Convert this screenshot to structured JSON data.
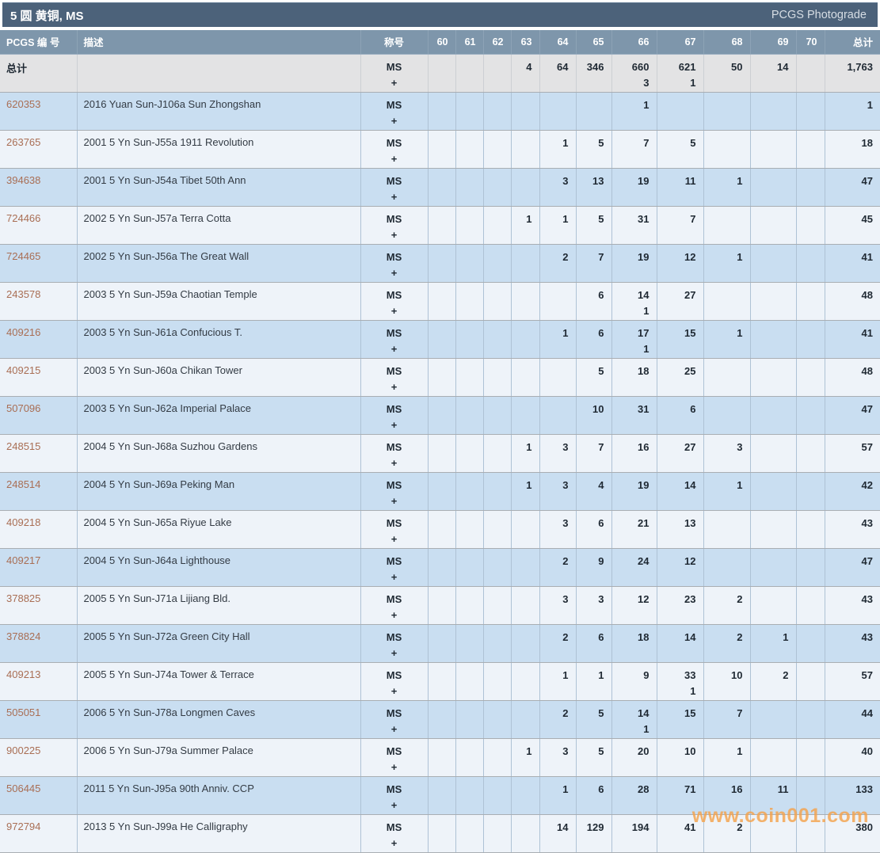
{
  "header": {
    "title": "5 圆 黄铜, MS",
    "right_link": "PCGS Photograde"
  },
  "table": {
    "fixed_headers": [
      "PCGS 编 号",
      "描述",
      "称号"
    ],
    "grade_columns": [
      "60",
      "61",
      "62",
      "63",
      "64",
      "65",
      "66",
      "67",
      "68",
      "69",
      "70"
    ],
    "total_header": "总计",
    "designation": [
      "MS",
      "+"
    ],
    "totals_row": {
      "label": "总计",
      "grades": {
        "63": [
          4,
          null
        ],
        "64": [
          64,
          null
        ],
        "65": [
          346,
          null
        ],
        "66": [
          660,
          3
        ],
        "67": [
          621,
          1
        ],
        "68": [
          50,
          null
        ],
        "69": [
          14,
          null
        ]
      },
      "total": "1,763"
    },
    "rows": [
      {
        "id": "620353",
        "desc": "2016 Yuan Sun-J106a Sun Zhongshan",
        "grades": {
          "66": [
            1,
            null
          ]
        },
        "total": "1"
      },
      {
        "id": "263765",
        "desc": "2001 5 Yn Sun-J55a 1911 Revolution",
        "grades": {
          "64": [
            1,
            null
          ],
          "65": [
            5,
            null
          ],
          "66": [
            7,
            null
          ],
          "67": [
            5,
            null
          ]
        },
        "total": "18"
      },
      {
        "id": "394638",
        "desc": "2001 5 Yn Sun-J54a Tibet 50th Ann",
        "grades": {
          "64": [
            3,
            null
          ],
          "65": [
            13,
            null
          ],
          "66": [
            19,
            null
          ],
          "67": [
            11,
            null
          ],
          "68": [
            1,
            null
          ]
        },
        "total": "47"
      },
      {
        "id": "724466",
        "desc": "2002 5 Yn Sun-J57a Terra Cotta",
        "grades": {
          "63": [
            1,
            null
          ],
          "64": [
            1,
            null
          ],
          "65": [
            5,
            null
          ],
          "66": [
            31,
            null
          ],
          "67": [
            7,
            null
          ]
        },
        "total": "45"
      },
      {
        "id": "724465",
        "desc": "2002 5 Yn Sun-J56a The Great Wall",
        "grades": {
          "64": [
            2,
            null
          ],
          "65": [
            7,
            null
          ],
          "66": [
            19,
            null
          ],
          "67": [
            12,
            null
          ],
          "68": [
            1,
            null
          ]
        },
        "total": "41"
      },
      {
        "id": "243578",
        "desc": "2003 5 Yn Sun-J59a Chaotian Temple",
        "grades": {
          "65": [
            6,
            null
          ],
          "66": [
            14,
            1
          ],
          "67": [
            27,
            null
          ]
        },
        "total": "48"
      },
      {
        "id": "409216",
        "desc": "2003 5 Yn Sun-J61a Confucious T.",
        "grades": {
          "64": [
            1,
            null
          ],
          "65": [
            6,
            null
          ],
          "66": [
            17,
            1
          ],
          "67": [
            15,
            null
          ],
          "68": [
            1,
            null
          ]
        },
        "total": "41"
      },
      {
        "id": "409215",
        "desc": "2003 5 Yn Sun-J60a Chikan Tower",
        "grades": {
          "65": [
            5,
            null
          ],
          "66": [
            18,
            null
          ],
          "67": [
            25,
            null
          ]
        },
        "total": "48"
      },
      {
        "id": "507096",
        "desc": "2003 5 Yn Sun-J62a Imperial Palace",
        "grades": {
          "65": [
            10,
            null
          ],
          "66": [
            31,
            null
          ],
          "67": [
            6,
            null
          ]
        },
        "total": "47"
      },
      {
        "id": "248515",
        "desc": "2004 5 Yn Sun-J68a Suzhou Gardens",
        "grades": {
          "63": [
            1,
            null
          ],
          "64": [
            3,
            null
          ],
          "65": [
            7,
            null
          ],
          "66": [
            16,
            null
          ],
          "67": [
            27,
            null
          ],
          "68": [
            3,
            null
          ]
        },
        "total": "57"
      },
      {
        "id": "248514",
        "desc": "2004 5 Yn Sun-J69a Peking Man",
        "grades": {
          "63": [
            1,
            null
          ],
          "64": [
            3,
            null
          ],
          "65": [
            4,
            null
          ],
          "66": [
            19,
            null
          ],
          "67": [
            14,
            null
          ],
          "68": [
            1,
            null
          ]
        },
        "total": "42"
      },
      {
        "id": "409218",
        "desc": "2004 5 Yn Sun-J65a Riyue Lake",
        "grades": {
          "64": [
            3,
            null
          ],
          "65": [
            6,
            null
          ],
          "66": [
            21,
            null
          ],
          "67": [
            13,
            null
          ]
        },
        "total": "43"
      },
      {
        "id": "409217",
        "desc": "2004 5 Yn Sun-J64a Lighthouse",
        "grades": {
          "64": [
            2,
            null
          ],
          "65": [
            9,
            null
          ],
          "66": [
            24,
            null
          ],
          "67": [
            12,
            null
          ]
        },
        "total": "47"
      },
      {
        "id": "378825",
        "desc": "2005 5 Yn Sun-J71a Lijiang Bld.",
        "grades": {
          "64": [
            3,
            null
          ],
          "65": [
            3,
            null
          ],
          "66": [
            12,
            null
          ],
          "67": [
            23,
            null
          ],
          "68": [
            2,
            null
          ]
        },
        "total": "43"
      },
      {
        "id": "378824",
        "desc": "2005 5 Yn Sun-J72a Green City Hall",
        "grades": {
          "64": [
            2,
            null
          ],
          "65": [
            6,
            null
          ],
          "66": [
            18,
            null
          ],
          "67": [
            14,
            null
          ],
          "68": [
            2,
            null
          ],
          "69": [
            1,
            null
          ]
        },
        "total": "43"
      },
      {
        "id": "409213",
        "desc": "2005 5 Yn Sun-J74a Tower & Terrace",
        "grades": {
          "64": [
            1,
            null
          ],
          "65": [
            1,
            null
          ],
          "66": [
            9,
            null
          ],
          "67": [
            33,
            1
          ],
          "68": [
            10,
            null
          ],
          "69": [
            2,
            null
          ]
        },
        "total": "57"
      },
      {
        "id": "505051",
        "desc": "2006 5 Yn Sun-J78a Longmen Caves",
        "grades": {
          "64": [
            2,
            null
          ],
          "65": [
            5,
            null
          ],
          "66": [
            14,
            1
          ],
          "67": [
            15,
            null
          ],
          "68": [
            7,
            null
          ]
        },
        "total": "44"
      },
      {
        "id": "900225",
        "desc": "2006 5 Yn Sun-J79a Summer Palace",
        "grades": {
          "63": [
            1,
            null
          ],
          "64": [
            3,
            null
          ],
          "65": [
            5,
            null
          ],
          "66": [
            20,
            null
          ],
          "67": [
            10,
            null
          ],
          "68": [
            1,
            null
          ]
        },
        "total": "40"
      },
      {
        "id": "506445",
        "desc": "2011 5 Yn Sun-J95a 90th Anniv. CCP",
        "grades": {
          "64": [
            1,
            null
          ],
          "65": [
            6,
            null
          ],
          "66": [
            28,
            null
          ],
          "67": [
            71,
            null
          ],
          "68": [
            16,
            null
          ],
          "69": [
            11,
            null
          ]
        },
        "total": "133"
      },
      {
        "id": "972794",
        "desc": "2013 5 Yn Sun-J99a He Calligraphy",
        "grades": {
          "64": [
            14,
            null
          ],
          "65": [
            129,
            null
          ],
          "66": [
            194,
            null
          ],
          "67": [
            41,
            null
          ],
          "68": [
            2,
            null
          ]
        },
        "total": "380"
      }
    ]
  },
  "watermark": {
    "text": "www.coin001.com",
    "color": "#f4a24c"
  },
  "colors": {
    "title_bar": "#4c627a",
    "column_header": "#7e96ab",
    "row_blue": "#c9def1",
    "row_light": "#eef3f9",
    "totals_row": "#e3e3e4",
    "link": "#a96e54"
  }
}
